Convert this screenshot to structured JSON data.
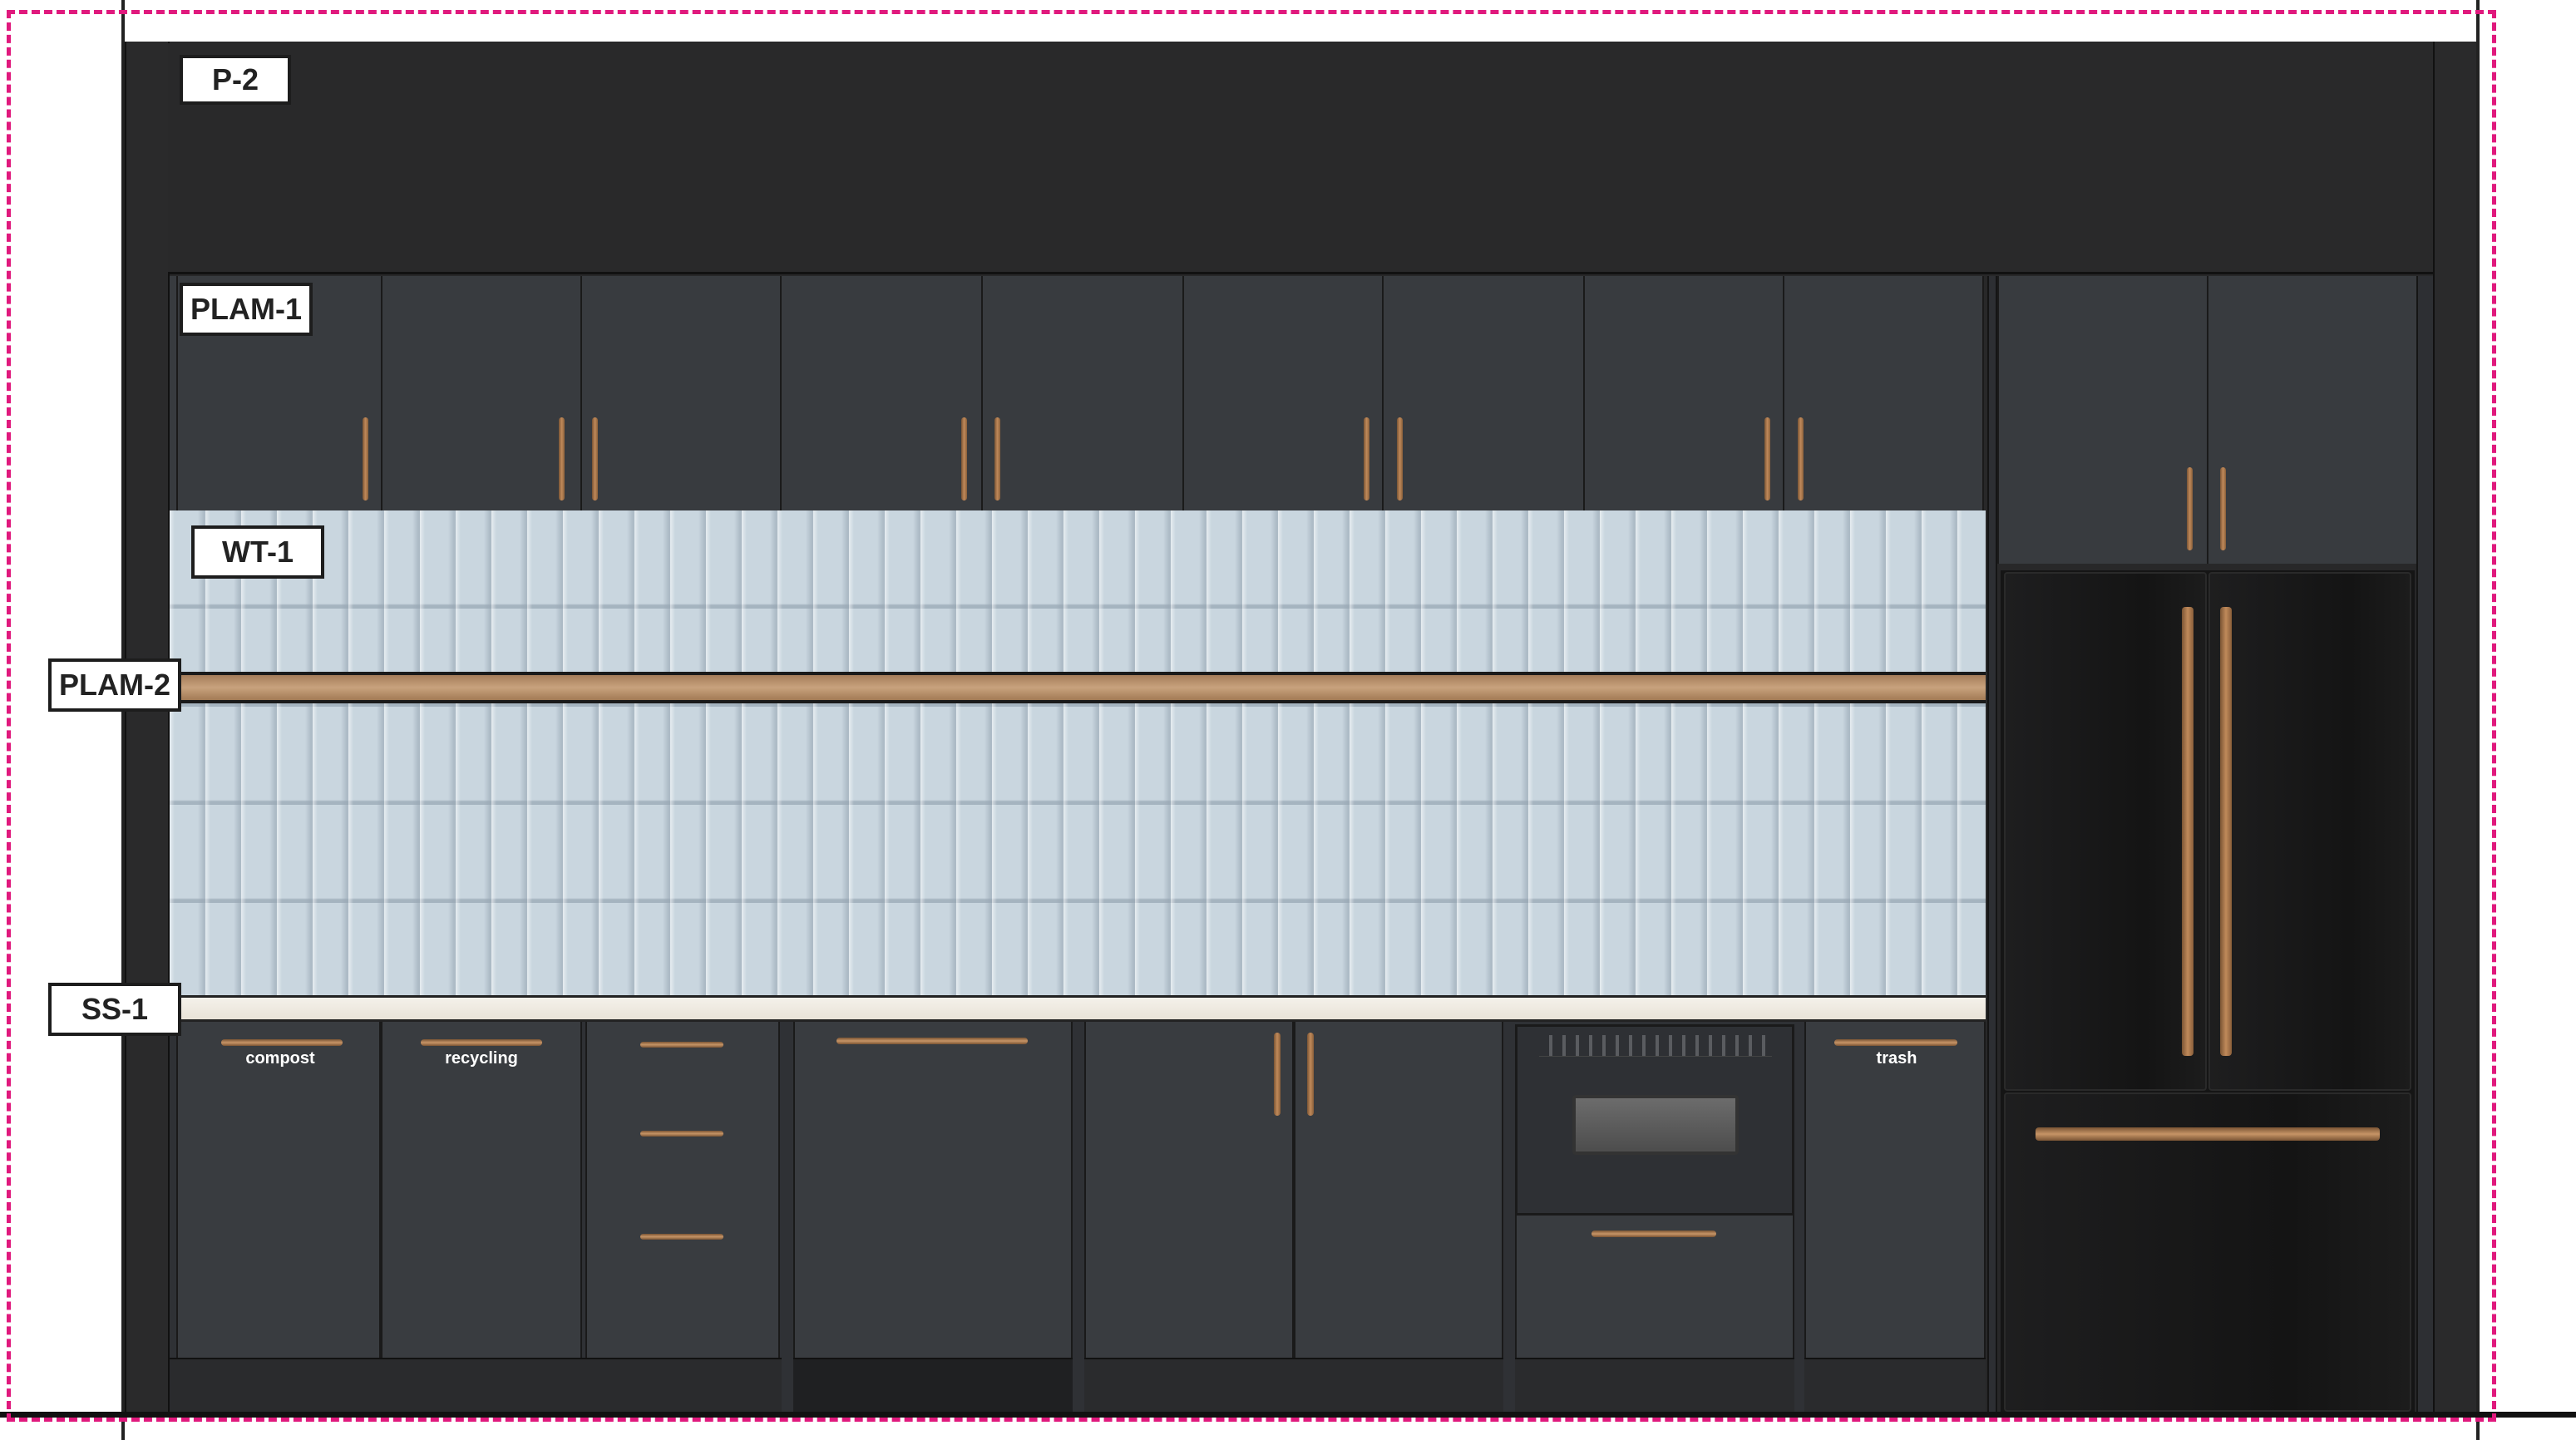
{
  "labels": {
    "p2": "P-2",
    "plam1": "PLAM-1",
    "wt1": "WT-1",
    "plam2": "PLAM-2",
    "ss1": "SS-1"
  },
  "bins": {
    "compost": "compost",
    "recycling": "recycling",
    "trash": "trash"
  },
  "colors": {
    "wall": "#282829",
    "cabinet": "#393c40",
    "tile": "#c9d6df",
    "wood": "#c8a27d",
    "brass": "#c08a5a",
    "border_dash": "#e0197d"
  },
  "icons": {
    "fridge": "french-door-refrigerator-icon",
    "oven": "microwave-drawer-icon"
  }
}
